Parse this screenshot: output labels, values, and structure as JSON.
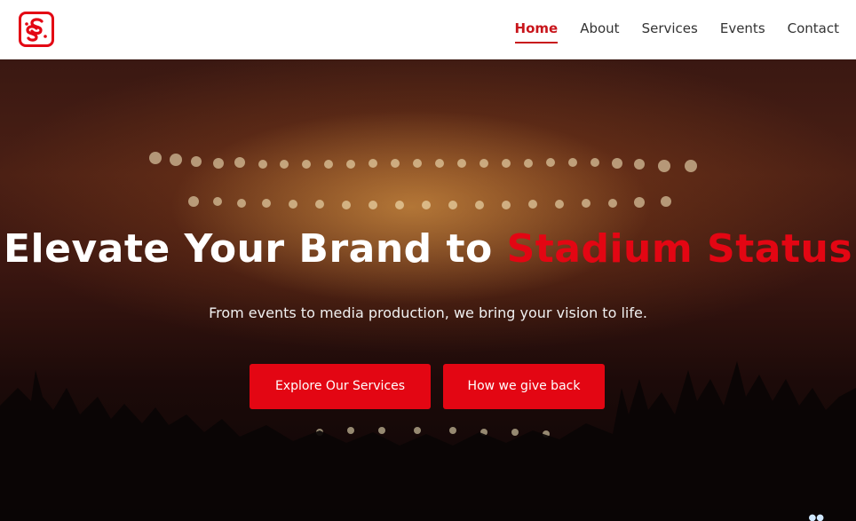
{
  "brand": {
    "logo_text": "SS",
    "logo_color": "#e30613"
  },
  "nav": {
    "items": [
      {
        "label": "Home",
        "active": true
      },
      {
        "label": "About",
        "active": false
      },
      {
        "label": "Services",
        "active": false
      },
      {
        "label": "Events",
        "active": false
      },
      {
        "label": "Contact",
        "active": false
      }
    ],
    "active_color": "#c8151b"
  },
  "hero": {
    "title_plain": "Elevate Your Brand to ",
    "title_accent": "Stadium Status",
    "subtitle": "From events to media production, we bring your vision to life.",
    "buttons": [
      {
        "label": "Explore Our Services"
      },
      {
        "label": "How we give back"
      }
    ],
    "accent_color": "#e30613",
    "background_icon": "concert-crowd-image"
  }
}
